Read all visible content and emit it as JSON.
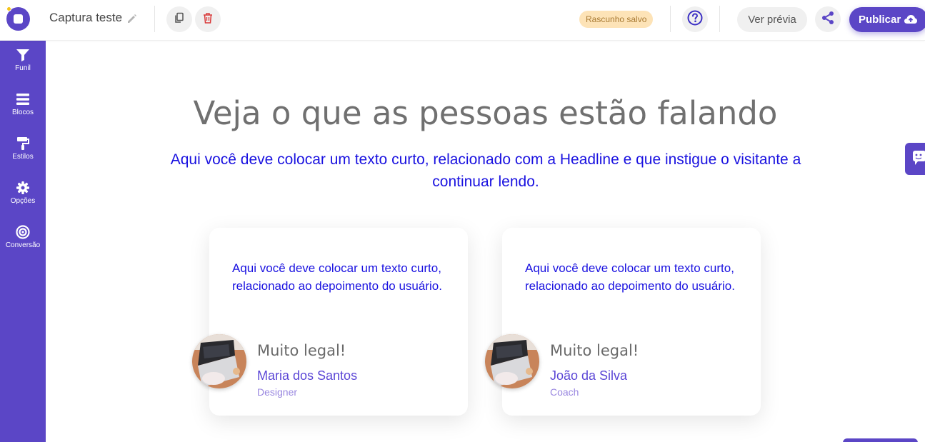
{
  "header": {
    "project_name": "Captura teste",
    "status_badge": "Rascunho salvo",
    "preview_label": "Ver prévia",
    "publish_label": "Publicar"
  },
  "sidebar": {
    "items": [
      {
        "label": "Funil",
        "icon": "filter-icon"
      },
      {
        "label": "Blocos",
        "icon": "blocks-icon"
      },
      {
        "label": "Estilos",
        "icon": "paint-roller-icon"
      },
      {
        "label": "Opções",
        "icon": "gear-icon"
      },
      {
        "label": "Conversão",
        "icon": "target-icon"
      }
    ]
  },
  "main": {
    "headline": "Veja o que as pessoas estão falando",
    "subtitle": "Aqui você deve colocar um texto curto, relacionado com a Headline e que instigue o visitante a continuar lendo.",
    "testimonials": [
      {
        "quote": "Aqui você deve colocar um texto curto, relacionado ao depoimento do usuário.",
        "title": "Muito legal!",
        "name": "Maria dos Santos",
        "role": "Designer"
      },
      {
        "quote": "Aqui você deve colocar um texto curto, relacionado ao depoimento do usuário.",
        "title": "Muito legal!",
        "name": "João da Silva",
        "role": "Coach"
      }
    ]
  },
  "colors": {
    "brand": "#5b46c6",
    "text_blue": "#1a12e0",
    "badge_bg": "#fde3b7"
  }
}
